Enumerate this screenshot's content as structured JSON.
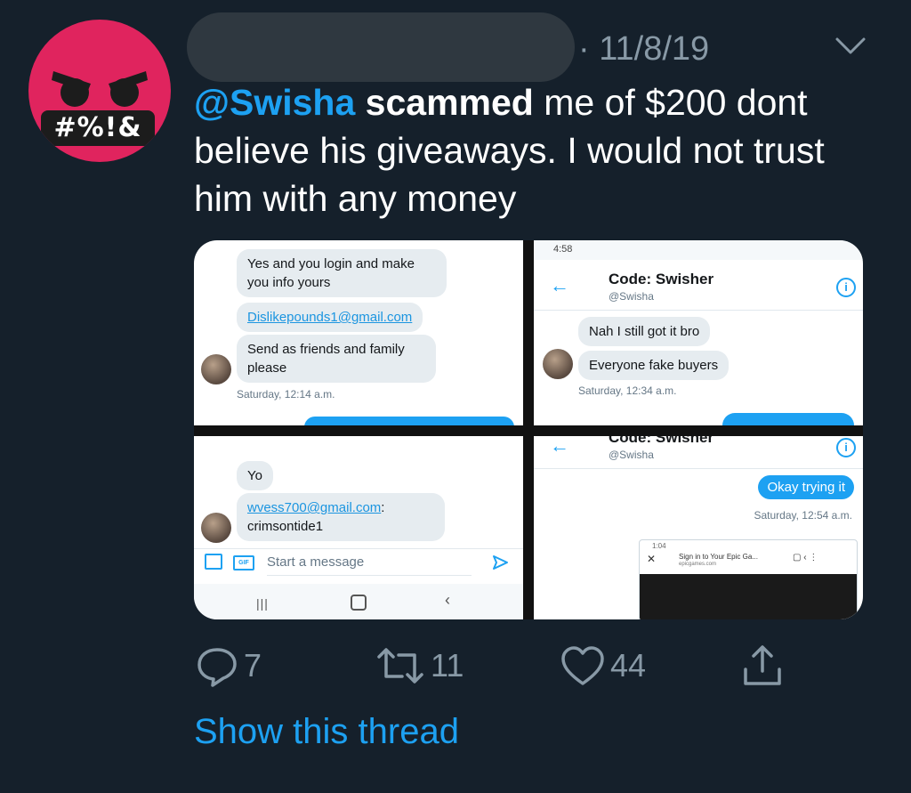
{
  "tweet": {
    "date_prefix": "·",
    "date": "11/8/19",
    "mention": "@Swisha",
    "bold_word": "scammed",
    "text_rest": " me of $200 dont believe his giveaways. I would not trust him with any money",
    "avatar_badge": "#%!&"
  },
  "media": {
    "p1": {
      "bubble1": "Yes and you login and make you info yours",
      "link": "Dislikepounds1@gmail.com",
      "bubble2": "Send as friends and family please",
      "time": "Saturday, 12:14 a.m."
    },
    "p2": {
      "status_time": "4:58",
      "title": "Code: Swisher",
      "handle": "@Swisha",
      "bubble1": "Nah I still got it bro",
      "bubble2": "Everyone fake buyers",
      "time": "Saturday, 12:34 a.m."
    },
    "p3": {
      "bubble1": "Yo",
      "link": "wvess700@gmail.com",
      "link_suffix": ":",
      "bubble2": "crimsontide1",
      "placeholder": "Start a message"
    },
    "p4": {
      "title": "Code: Swisher",
      "handle": "@Swisha",
      "sent": "Okay trying it",
      "time": "Saturday, 12:54 a.m.",
      "mini_time": "1:04",
      "mini_title": "Sign in to Your Epic Ga...",
      "mini_url": "epicgames.com"
    }
  },
  "actions": {
    "replies": "7",
    "retweets": "11",
    "likes": "44"
  },
  "show_thread": "Show this thread",
  "colors": {
    "background": "#15202b",
    "accent": "#1da1f2",
    "muted": "#8899a6",
    "avatar": "#e0245e"
  }
}
